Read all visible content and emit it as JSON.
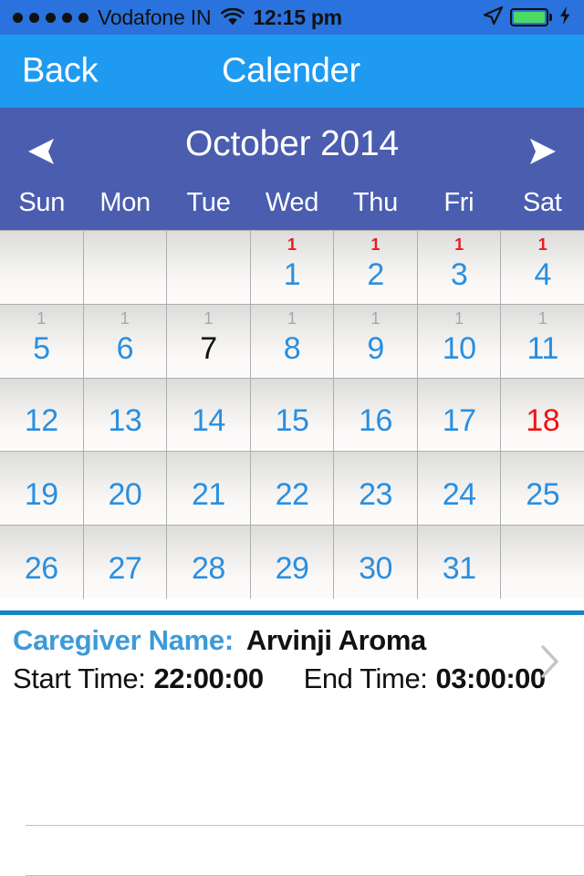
{
  "status_bar": {
    "signal_dots": 5,
    "carrier": "Vodafone IN",
    "wifi_icon": "wifi-icon",
    "time": "12:15 pm",
    "location_icon": "location-arrow-icon",
    "battery_icon": "battery-icon",
    "battery_level": 100,
    "charging_icon": "lightning-bolt-icon",
    "bg_color": "#2a72de",
    "battery_color": "#4cd964"
  },
  "nav_bar": {
    "back_label": "Back",
    "title": "Calender",
    "bg_color": "#1e9af0"
  },
  "calendar": {
    "header": {
      "month_label": "October 2014",
      "prev_icon": "triangle-left-icon",
      "next_icon": "triangle-right-icon",
      "bg_color": "#4a5daf"
    },
    "weekdays": [
      "Sun",
      "Mon",
      "Tue",
      "Wed",
      "Thu",
      "Fri",
      "Sat"
    ],
    "day_color": "#2a8fe0",
    "selected_color": "#ee1414",
    "badge_red_color": "#e81c1c",
    "badge_gray_color": "#a7a7a7",
    "cells": [
      {
        "num": "",
        "badge": "",
        "badge_style": "",
        "num_style": "",
        "empty": true
      },
      {
        "num": "",
        "badge": "",
        "badge_style": "",
        "num_style": "",
        "empty": true
      },
      {
        "num": "",
        "badge": "",
        "badge_style": "",
        "num_style": "",
        "empty": true
      },
      {
        "num": "1",
        "badge": "1",
        "badge_style": "red",
        "num_style": "",
        "empty": false
      },
      {
        "num": "2",
        "badge": "1",
        "badge_style": "red",
        "num_style": "",
        "empty": false
      },
      {
        "num": "3",
        "badge": "1",
        "badge_style": "red",
        "num_style": "",
        "empty": false
      },
      {
        "num": "4",
        "badge": "1",
        "badge_style": "red",
        "num_style": "",
        "empty": false
      },
      {
        "num": "5",
        "badge": "1",
        "badge_style": "gray",
        "num_style": "",
        "empty": false
      },
      {
        "num": "6",
        "badge": "1",
        "badge_style": "gray",
        "num_style": "",
        "empty": false
      },
      {
        "num": "7",
        "badge": "1",
        "badge_style": "gray",
        "num_style": "black",
        "empty": false
      },
      {
        "num": "8",
        "badge": "1",
        "badge_style": "gray",
        "num_style": "",
        "empty": false
      },
      {
        "num": "9",
        "badge": "1",
        "badge_style": "gray",
        "num_style": "",
        "empty": false
      },
      {
        "num": "10",
        "badge": "1",
        "badge_style": "gray",
        "num_style": "",
        "empty": false
      },
      {
        "num": "11",
        "badge": "1",
        "badge_style": "gray",
        "num_style": "",
        "empty": false
      },
      {
        "num": "12",
        "badge": "",
        "badge_style": "",
        "num_style": "",
        "empty": false
      },
      {
        "num": "13",
        "badge": "",
        "badge_style": "",
        "num_style": "",
        "empty": false
      },
      {
        "num": "14",
        "badge": "",
        "badge_style": "",
        "num_style": "",
        "empty": false
      },
      {
        "num": "15",
        "badge": "",
        "badge_style": "",
        "num_style": "",
        "empty": false
      },
      {
        "num": "16",
        "badge": "",
        "badge_style": "",
        "num_style": "",
        "empty": false
      },
      {
        "num": "17",
        "badge": "",
        "badge_style": "",
        "num_style": "",
        "empty": false
      },
      {
        "num": "18",
        "badge": "",
        "badge_style": "",
        "num_style": "red",
        "empty": false
      },
      {
        "num": "19",
        "badge": "",
        "badge_style": "",
        "num_style": "",
        "empty": false
      },
      {
        "num": "20",
        "badge": "",
        "badge_style": "",
        "num_style": "",
        "empty": false
      },
      {
        "num": "21",
        "badge": "",
        "badge_style": "",
        "num_style": "",
        "empty": false
      },
      {
        "num": "22",
        "badge": "",
        "badge_style": "",
        "num_style": "",
        "empty": false
      },
      {
        "num": "23",
        "badge": "",
        "badge_style": "",
        "num_style": "",
        "empty": false
      },
      {
        "num": "24",
        "badge": "",
        "badge_style": "",
        "num_style": "",
        "empty": false
      },
      {
        "num": "25",
        "badge": "",
        "badge_style": "",
        "num_style": "",
        "empty": false
      },
      {
        "num": "26",
        "badge": "",
        "badge_style": "",
        "num_style": "",
        "empty": false
      },
      {
        "num": "27",
        "badge": "",
        "badge_style": "",
        "num_style": "",
        "empty": false
      },
      {
        "num": "28",
        "badge": "",
        "badge_style": "",
        "num_style": "",
        "empty": false
      },
      {
        "num": "29",
        "badge": "",
        "badge_style": "",
        "num_style": "",
        "empty": false
      },
      {
        "num": "30",
        "badge": "",
        "badge_style": "",
        "num_style": "",
        "empty": false
      },
      {
        "num": "31",
        "badge": "",
        "badge_style": "",
        "num_style": "",
        "empty": false
      },
      {
        "num": "",
        "badge": "",
        "badge_style": "",
        "num_style": "",
        "empty": true
      }
    ]
  },
  "separator_color": "#1783c7",
  "detail": {
    "caregiver_label": "Caregiver Name:",
    "caregiver_name": "Arvinji Aroma",
    "start_time_label": "Start Time:",
    "start_time_value": "22:00:00",
    "end_time_label": "End Time:",
    "end_time_value": "03:00:00",
    "disclosure_icon": "chevron-right-icon",
    "label_color": "#3d9ad8"
  }
}
